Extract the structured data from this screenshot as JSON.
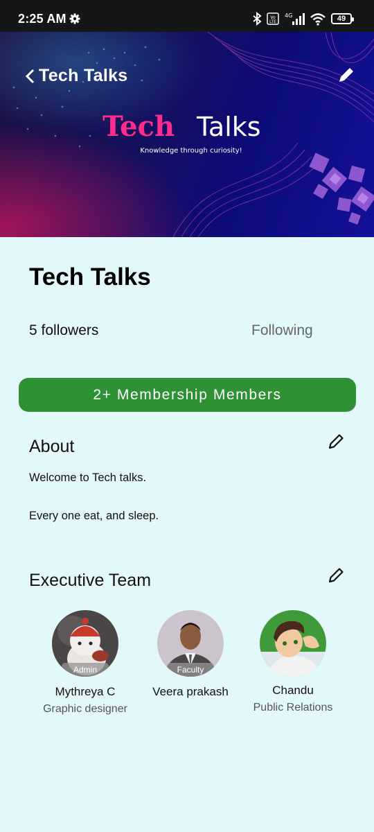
{
  "status_bar": {
    "time": "2:25 AM",
    "network": "4G",
    "battery": "49",
    "icons": [
      "gear-icon",
      "bluetooth-icon",
      "volte-icon",
      "signal-icon",
      "wifi-icon",
      "battery-icon"
    ]
  },
  "header": {
    "back_title": "Tech Talks",
    "logo_word_1": "Tech",
    "logo_word_2": "Talks",
    "logo_tagline": "Knowledge through curiosity!"
  },
  "group": {
    "name": "Tech Talks",
    "followers_count": "5",
    "followers_label": "followers",
    "follow_status": "Following",
    "membership_button": "2+ Membership Members"
  },
  "about": {
    "title": "About",
    "line1": "Welcome to Tech talks.",
    "line2": "Every one eat, and sleep."
  },
  "executive_team": {
    "title": "Executive Team",
    "members": [
      {
        "name": "Mythreya C",
        "badge": "Admin",
        "role": "Graphic designer"
      },
      {
        "name": "Veera prakash",
        "badge": "Faculty",
        "role": ""
      },
      {
        "name": "Chandu",
        "badge": "",
        "role": "Public Relations"
      }
    ]
  },
  "colors": {
    "page_background": "#e2f8fa",
    "membership_button": "#2e9235",
    "banner_background": "#14105e",
    "logo_accent": "#ff2c8e"
  }
}
